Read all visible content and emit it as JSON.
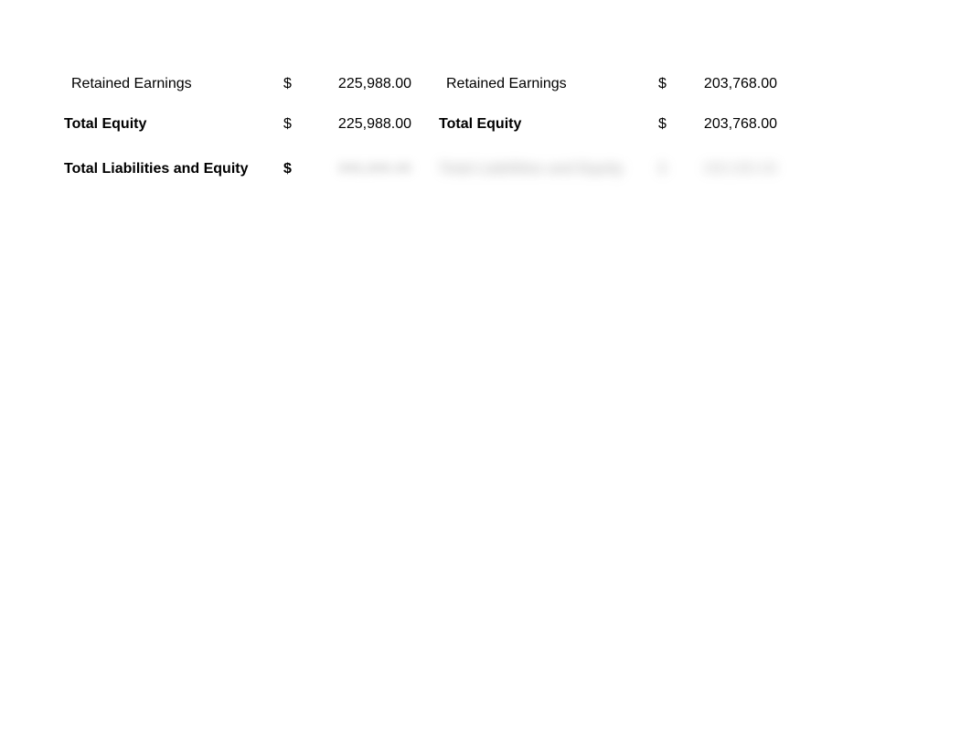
{
  "rows": {
    "retained_earnings": {
      "left": {
        "label": "Retained Earnings",
        "currency": "$",
        "value": "225,988.00"
      },
      "right": {
        "label": "Retained Earnings",
        "currency": "$",
        "value": "203,768.00"
      }
    },
    "total_equity": {
      "left": {
        "label": "Total Equity",
        "currency": "$",
        "value": "225,988.00"
      },
      "right": {
        "label": "Total Equity",
        "currency": "$",
        "value": "203,768.00"
      }
    },
    "total_liabilities_equity": {
      "left": {
        "label": "Total Liabilities and Equity",
        "currency": "$",
        "value": ""
      },
      "right": {
        "label": "",
        "currency": "",
        "value": ""
      }
    }
  }
}
